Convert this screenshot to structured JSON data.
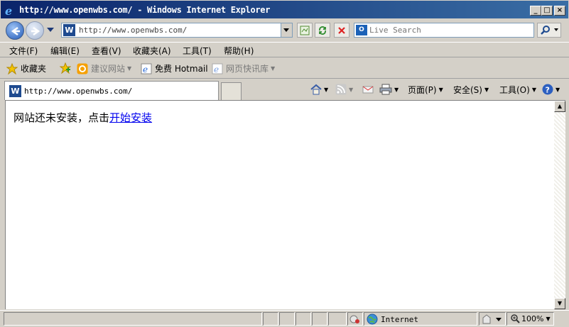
{
  "window": {
    "title": "http://www.openwbs.com/ - Windows Internet Explorer",
    "minimize": "_",
    "maximize": "□",
    "close": "×"
  },
  "nav": {
    "address": "http://www.openwbs.com/",
    "search_placeholder": "Live Search"
  },
  "menu": [
    "文件(F)",
    "编辑(E)",
    "查看(V)",
    "收藏夹(A)",
    "工具(T)",
    "帮助(H)"
  ],
  "favorites": {
    "label": "收藏夹",
    "items": [
      "建议网站",
      "免费 Hotmail",
      "网页快讯库"
    ]
  },
  "tab": {
    "title": "http://www.openwbs.com/"
  },
  "commandbar": {
    "page": "页面(P)",
    "safety": "安全(S)",
    "tools": "工具(O)"
  },
  "content": {
    "message": "网站还未安装，点击",
    "link": "开始安装"
  },
  "status": {
    "zone": "Internet",
    "zoom": "100%"
  }
}
